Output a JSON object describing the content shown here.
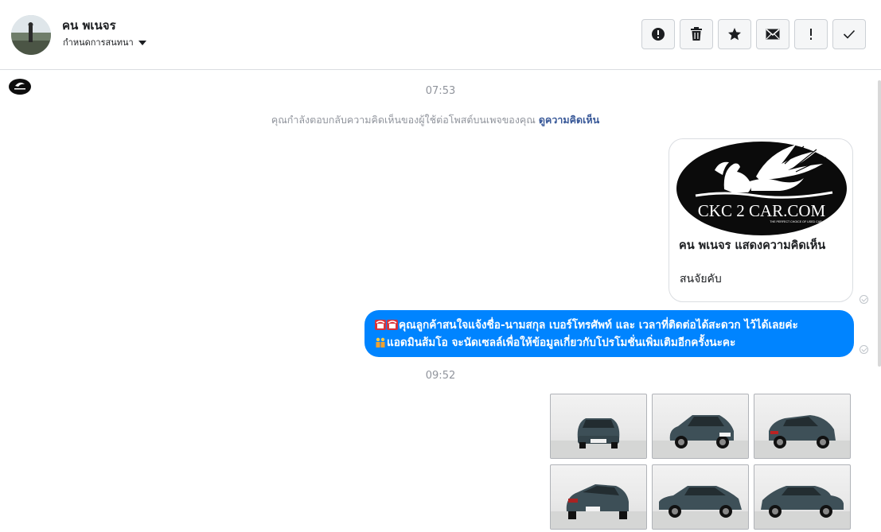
{
  "header": {
    "contact_name": "คน พเนจร",
    "assign_label": "กำหนดการสนทนา"
  },
  "actions": [
    {
      "name": "mark-spam-button",
      "icon": "alert-circle-icon"
    },
    {
      "name": "delete-button",
      "icon": "trash-icon"
    },
    {
      "name": "star-button",
      "icon": "star-icon"
    },
    {
      "name": "mark-unread-button",
      "icon": "envelope-icon"
    },
    {
      "name": "follow-up-button",
      "icon": "exclamation-icon"
    },
    {
      "name": "mark-done-button",
      "icon": "checkmark-icon"
    }
  ],
  "thread": {
    "time_1": "07:53",
    "notice_text": "คุณกำลังตอบกลับความคิดเห็นของผู้ใช้ต่อโพสต์บนเพจของคุณ",
    "notice_link": "ดูความคิดเห็น",
    "card": {
      "logo_text": "CKC 2 CAR.COM",
      "logo_tagline": "THE PERFECT CHOICE OF USED CAR",
      "title": "คน พเนจร แสดงความคิดเห็น",
      "body": "สนจัยคับ"
    },
    "message": {
      "line1": "คุณลูกค้าสนใจแจ้งชื่อ-นามสกุล เบอร์โทรศัพท์ และ เวลาที่ติดต่อได้สะดวก ไว้ได้เลยค่ะ",
      "line2": "แอดมินส้มโอ จะนัดเซลล์เพื่อให้ข้อมูลเกี่ยวกับโปรโมชั่นเพิ่มเติมอีกครั้งนะคะ",
      "emoji_1": "telephone-emoji",
      "emoji_2": "people-emoji"
    },
    "time_2": "09:52",
    "photo_count": 6
  },
  "colors": {
    "bubble": "#0084ff",
    "link": "#385898",
    "meta_text": "#90949c",
    "border": "#dadde1"
  }
}
